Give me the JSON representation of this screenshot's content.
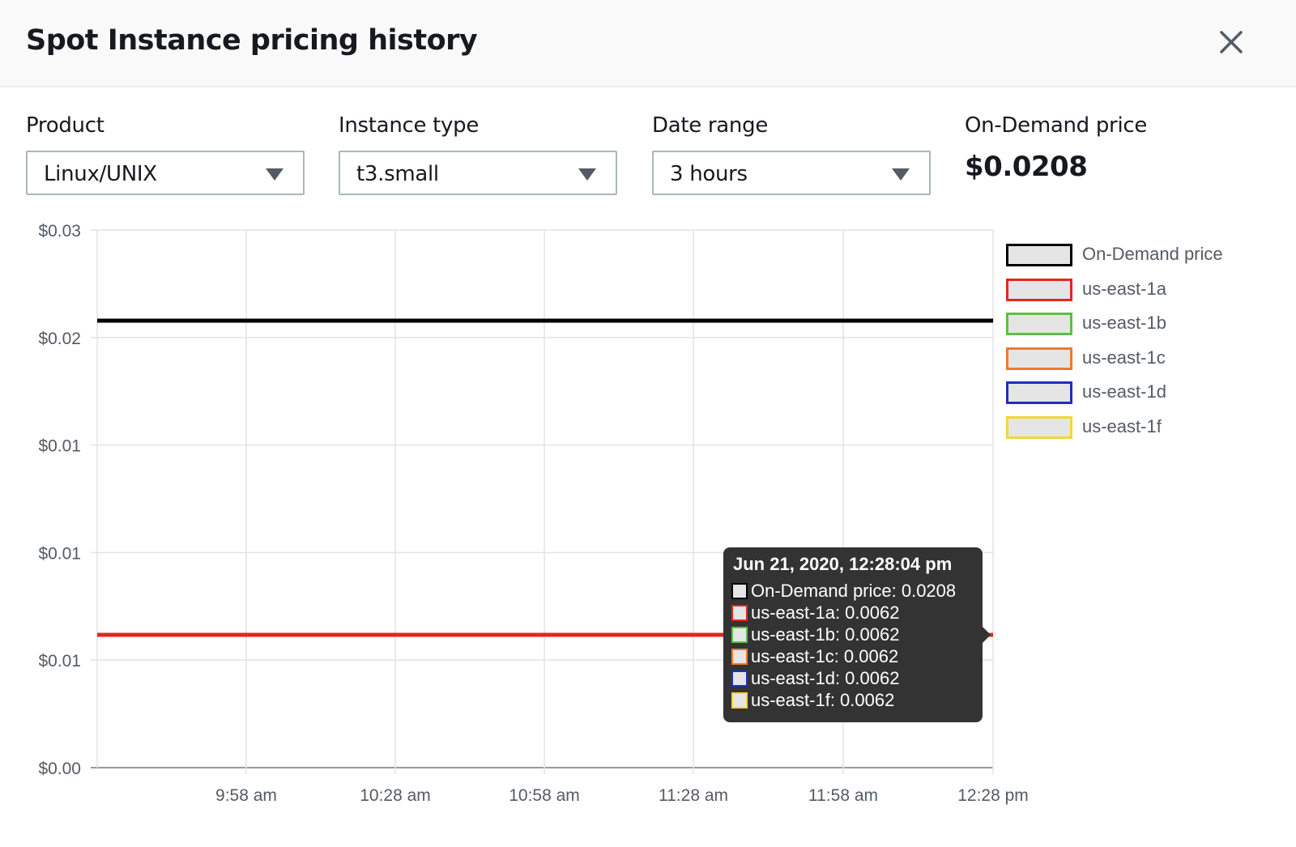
{
  "header": {
    "title": "Spot Instance pricing history",
    "close_icon": "close-icon"
  },
  "filters": {
    "product": {
      "label": "Product",
      "value": "Linux/UNIX"
    },
    "instance_type": {
      "label": "Instance type",
      "value": "t3.small"
    },
    "date_range": {
      "label": "Date range",
      "value": "3 hours"
    },
    "on_demand": {
      "label": "On-Demand price",
      "value": "$0.0208"
    }
  },
  "colors": {
    "on_demand": "#000000",
    "us-east-1a": "#e2281f",
    "us-east-1b": "#5cbf47",
    "us-east-1c": "#ec7b2e",
    "us-east-1d": "#1f2fbf",
    "us-east-1f": "#f5d43c"
  },
  "tooltip": {
    "title": "Jun 21, 2020, 12:28:04 pm",
    "rows": [
      {
        "text": "On-Demand price: 0.0208",
        "color": "#000000"
      },
      {
        "text": "us-east-1a: 0.0062",
        "color": "#e2281f"
      },
      {
        "text": "us-east-1b: 0.0062",
        "color": "#5cbf47"
      },
      {
        "text": "us-east-1c: 0.0062",
        "color": "#ec7b2e"
      },
      {
        "text": "us-east-1d: 0.0062",
        "color": "#1f2fbf"
      },
      {
        "text": "us-east-1f: 0.0062",
        "color": "#f5d43c"
      }
    ]
  },
  "chart_data": {
    "type": "line",
    "title": "",
    "xlabel": "",
    "ylabel": "",
    "x_ticks": [
      "9:58 am",
      "10:28 am",
      "10:58 am",
      "11:28 am",
      "11:58 am",
      "12:28 pm"
    ],
    "x_range": [
      "9:28 am",
      "12:28 pm"
    ],
    "y_ticks": [
      "$0.00",
      "$0.01",
      "$0.01",
      "$0.01",
      "$0.02",
      "$0.03"
    ],
    "y_tick_values": [
      0,
      0.005,
      0.01,
      0.015,
      0.02,
      0.025
    ],
    "ylim": [
      0,
      0.025
    ],
    "grid": true,
    "legend_position": "right",
    "series": [
      {
        "name": "On-Demand price",
        "color": "#000000",
        "values": [
          0.0208,
          0.0208
        ]
      },
      {
        "name": "us-east-1a",
        "color": "#e2281f",
        "values": [
          0.0062,
          0.0062
        ]
      },
      {
        "name": "us-east-1b",
        "color": "#5cbf47",
        "values": [
          0.0062,
          0.0062
        ]
      },
      {
        "name": "us-east-1c",
        "color": "#ec7b2e",
        "values": [
          0.0062,
          0.0062
        ]
      },
      {
        "name": "us-east-1d",
        "color": "#1f2fbf",
        "values": [
          0.0062,
          0.0062
        ]
      },
      {
        "name": "us-east-1f",
        "color": "#f5d43c",
        "values": [
          0.0062,
          0.0062
        ]
      }
    ]
  }
}
